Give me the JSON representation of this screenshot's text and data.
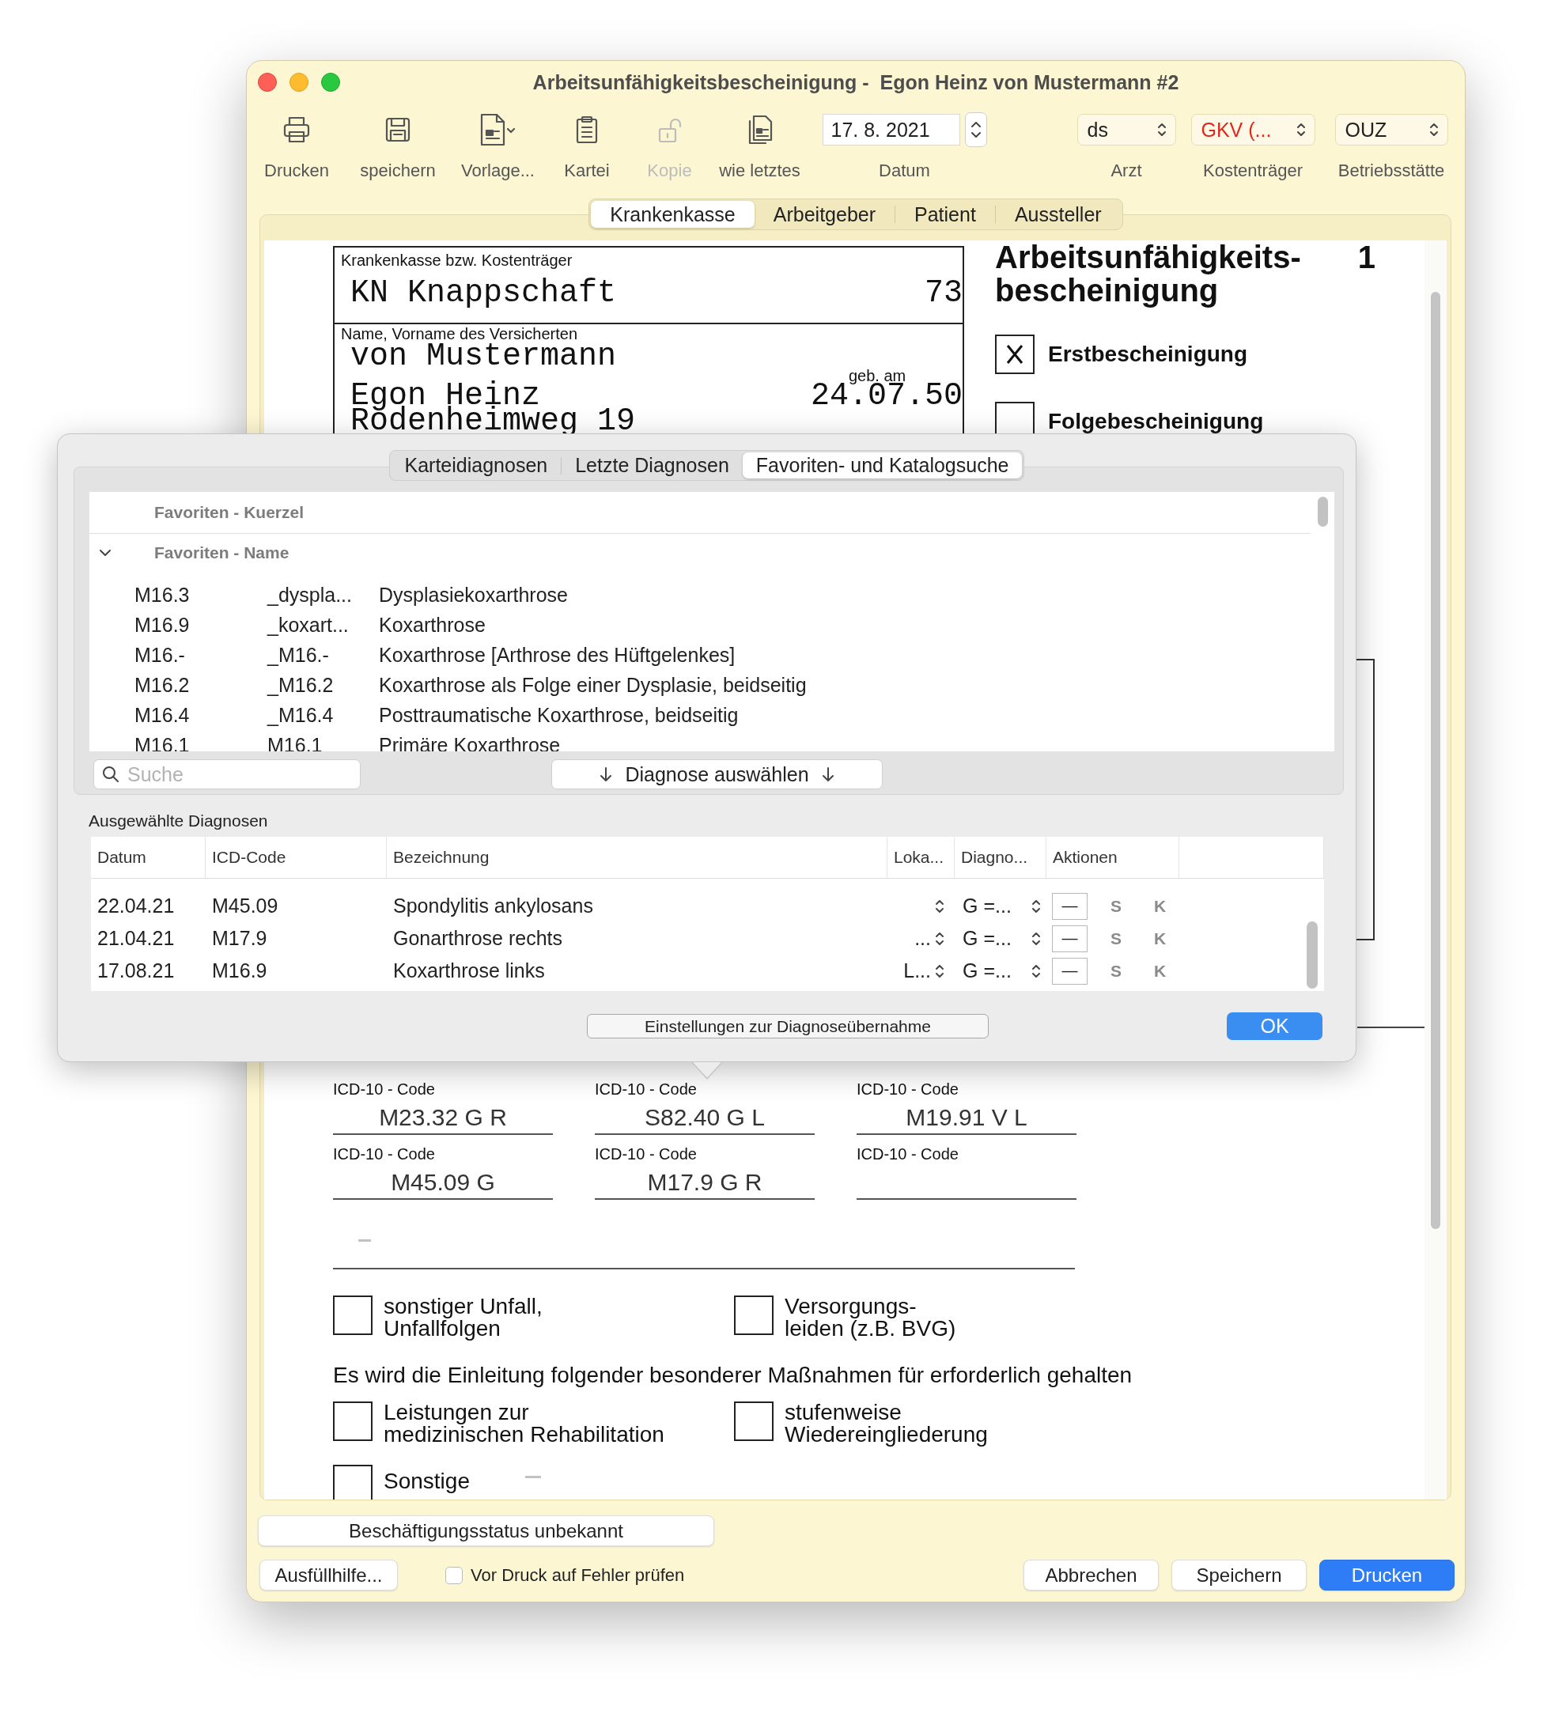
{
  "window": {
    "title": "Arbeitsunfähigkeitsbescheinigung -  Egon Heinz von Mustermann #2"
  },
  "toolbar": {
    "buttons": [
      {
        "label": "Drucken",
        "disabled": false
      },
      {
        "label": "speichern",
        "disabled": false
      },
      {
        "label": "Vorlage...",
        "disabled": false
      },
      {
        "label": "Kartei",
        "disabled": false
      },
      {
        "label": "Kopie",
        "disabled": true
      },
      {
        "label": "wie letztes",
        "disabled": false
      }
    ],
    "date": {
      "value": "17. 8. 2021",
      "label": "Datum"
    },
    "selectors": [
      {
        "value": "ds",
        "label": "Arzt",
        "warning": false
      },
      {
        "value": "GKV (...",
        "label": "Kostenträger",
        "warning": true
      },
      {
        "value": "OUZ",
        "label": "Betriebsstätte",
        "warning": false
      }
    ]
  },
  "tabs": [
    {
      "label": "Krankenkasse",
      "selected": true
    },
    {
      "label": "Arbeitgeber",
      "selected": false
    },
    {
      "label": "Patient",
      "selected": false
    },
    {
      "label": "Aussteller",
      "selected": false
    }
  ],
  "form": {
    "insurer_label": "Krankenkasse bzw. Kostenträger",
    "insurer": "KN Knappschaft",
    "insurer_code": "73",
    "name_label": "Name, Vorname des Versicherten",
    "surname": "von Mustermann",
    "given_names": "Egon Heinz",
    "birth_label": "geb. am",
    "birth_date": "24.07.50",
    "street": "Rodenheimweg 19",
    "title_lines": [
      "Arbeitsunfähigkeits-",
      "bescheinigung"
    ],
    "copy_number": "1",
    "certificate_types": [
      {
        "label": "Erstbescheinigung",
        "checked": true
      },
      {
        "label": "Folgebescheinigung",
        "checked": false
      }
    ],
    "icd_fields": [
      {
        "label": "ICD-10 - Code",
        "value": "M23.32 G R"
      },
      {
        "label": "ICD-10 - Code",
        "value": "S82.40 G L"
      },
      {
        "label": "ICD-10 - Code",
        "value": "M19.91 V L"
      },
      {
        "label": "ICD-10 - Code",
        "value": "M45.09 G"
      },
      {
        "label": "ICD-10 - Code",
        "value": "M17.9 G R"
      },
      {
        "label": "ICD-10 - Code"
      }
    ],
    "options": [
      {
        "label": "sonstiger Unfall,\nUnfallfolgen",
        "checked": false
      },
      {
        "label": "Versorgungs-\nleiden (z.B. BVG)",
        "checked": false
      }
    ],
    "measures_text": "Es wird die Einleitung folgender besonderer Maßnahmen für erforderlich gehalten",
    "measures": [
      {
        "label": "Leistungen zur\nmedizinischen Rehabilitation",
        "checked": false
      },
      {
        "label": "stufenweise\nWiedereingliederung",
        "checked": false
      }
    ],
    "other": {
      "label": "Sonstige",
      "checked": false
    }
  },
  "diagnosis_popover": {
    "tabs": [
      {
        "label": "Karteidiagnosen",
        "selected": false
      },
      {
        "label": "Letzte Diagnosen",
        "selected": false
      },
      {
        "label": "Favoriten- und Katalogsuche",
        "selected": true
      }
    ],
    "groups": [
      {
        "title": "Favoriten - Kuerzel"
      },
      {
        "title": "Favoriten - Name",
        "expanded": true
      }
    ],
    "rows": [
      {
        "code": "M16.3",
        "shortcut": "_dyspla...",
        "name": "Dysplasiekoxarthrose"
      },
      {
        "code": "M16.9",
        "shortcut": "_koxart...",
        "name": "Koxarthrose"
      },
      {
        "code": "M16.-",
        "shortcut": "_M16.-",
        "name": "Koxarthrose [Arthrose des Hüftgelenkes]"
      },
      {
        "code": "M16.2",
        "shortcut": "_M16.2",
        "name": "Koxarthrose als Folge einer Dysplasie, beidseitig"
      },
      {
        "code": "M16.4",
        "shortcut": "_M16.4",
        "name": "Posttraumatische Koxarthrose, beidseitig"
      },
      {
        "code": "M16.1",
        "shortcut": "M16.1",
        "name": "Primäre Koxarthrose"
      }
    ],
    "search": {
      "placeholder": "Suche"
    },
    "select_button": "Diagnose auswählen",
    "selected_heading": "Ausgewählte Diagnosen",
    "table": {
      "columns": [
        "Datum",
        "ICD-Code",
        "Bezeichnung",
        "Loka...",
        "Diagno...",
        "Aktionen"
      ],
      "rows": [
        {
          "date": "22.04.21",
          "code": "M45.09",
          "name": "Spondylitis ankylosans",
          "certainty": "G =...",
          "actions": [
            {
              "label": "—",
              "kind": "box"
            },
            {
              "label": "S",
              "kind": "text"
            },
            {
              "label": "K",
              "kind": "text"
            }
          ]
        },
        {
          "date": "21.04.21",
          "code": "M17.9",
          "name": "Gonarthrose rechts",
          "localization": "...",
          "certainty": "G =...",
          "actions": [
            {
              "label": "—",
              "kind": "box"
            },
            {
              "label": "S",
              "kind": "text"
            },
            {
              "label": "K",
              "kind": "text"
            }
          ]
        },
        {
          "date": "17.08.21",
          "code": "M16.9",
          "name": "Koxarthrose links",
          "localization": "L...",
          "certainty": "G =...",
          "actions": [
            {
              "label": "—",
              "kind": "box"
            },
            {
              "label": "S",
              "kind": "text"
            },
            {
              "label": "K",
              "kind": "text"
            }
          ]
        }
      ]
    },
    "settings_button": "Einstellungen zur Diagnoseübernahme",
    "ok_button": "OK"
  },
  "footer": {
    "status_button": "Beschäftigungsstatus unbekannt",
    "help_button": "Ausfüllhilfe...",
    "check": {
      "label": "Vor Druck auf Fehler prüfen",
      "checked": false
    },
    "buttons": [
      {
        "label": "Abbrechen",
        "primary": false
      },
      {
        "label": "Speichern",
        "primary": false
      },
      {
        "label": "Drucken",
        "primary": true
      }
    ]
  }
}
